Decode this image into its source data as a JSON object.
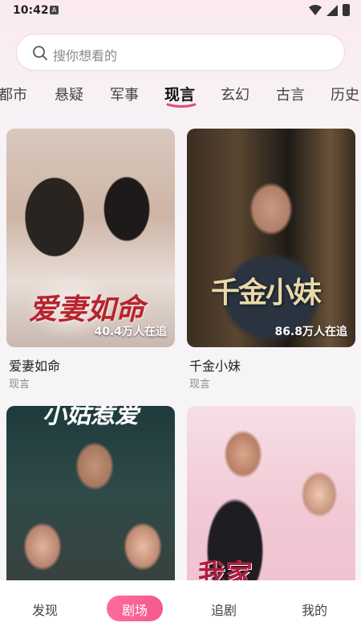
{
  "status": {
    "time": "10:42",
    "notif_badge": "A"
  },
  "search": {
    "placeholder": "搜你想看的"
  },
  "tabs": [
    "都市",
    "悬疑",
    "军事",
    "现言",
    "玄幻",
    "古言",
    "历史"
  ],
  "active_tab": "现言",
  "cards": [
    {
      "title": "爱妻如命",
      "genre": "现言",
      "views": "40.4万人在追",
      "poster_text": "爱妻如命"
    },
    {
      "title": "千金小妹",
      "genre": "现言",
      "views": "86.8万人在追",
      "poster_text": "千金小妹"
    },
    {
      "title": "",
      "genre": "",
      "views": "",
      "poster_text": "小姑惹爱"
    },
    {
      "title": "",
      "genre": "",
      "views": "",
      "poster_text": "我家"
    }
  ],
  "bottom_nav": [
    "发现",
    "剧场",
    "追剧",
    "我的"
  ],
  "active_nav": "剧场",
  "colors": {
    "accent": "#f25a8f",
    "tab_underline": "#e64a7f"
  }
}
